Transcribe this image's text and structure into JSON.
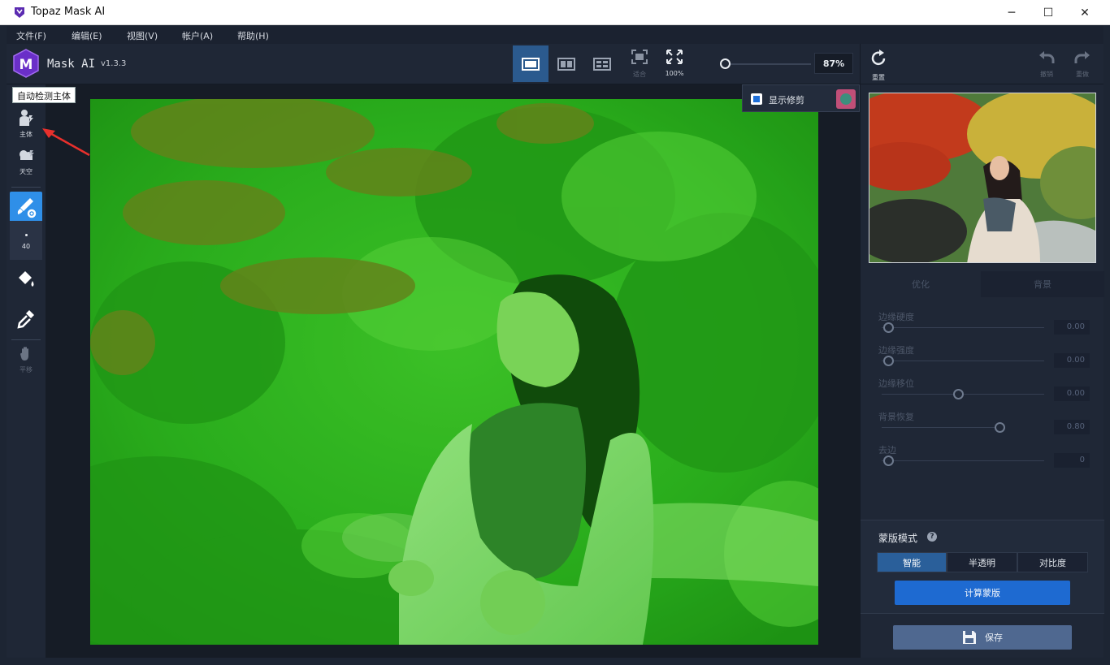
{
  "window": {
    "title": "Topaz Mask AI",
    "minimize": "─",
    "maximize": "☐",
    "close": "✕"
  },
  "menu": [
    {
      "label": "文件(F)"
    },
    {
      "label": "编辑(E)"
    },
    {
      "label": "视图(V)"
    },
    {
      "label": "帐户(A)"
    },
    {
      "label": "帮助(H)"
    }
  ],
  "toolbar": {
    "app_name": "Mask AI",
    "version": "v1.3.3",
    "fit_label": "适合",
    "zoom100_label": "100%",
    "zoom_value": "87%",
    "reset_label": "重置",
    "undo_label": "撤销",
    "redo_label": "重做"
  },
  "tools": {
    "subject_label": "主体",
    "sky_label": "天空",
    "brush_size": "40",
    "pan_label": "平移"
  },
  "tooltip": "自动检测主体",
  "show_trim": {
    "label": "显示修剪",
    "checked": true
  },
  "right_panel": {
    "tabs": [
      {
        "label": "优化"
      },
      {
        "label": "背景"
      }
    ],
    "params": [
      {
        "label": "边缘硬度",
        "value": "0.00"
      },
      {
        "label": "边缘强度",
        "value": "0.00"
      },
      {
        "label": "边缘移位",
        "value": "0.00"
      },
      {
        "label": "背景恢复",
        "value": "0.80"
      },
      {
        "label": "去边",
        "value": "0"
      }
    ],
    "mask_mode": {
      "title": "蒙版模式",
      "options": [
        {
          "label": "智能",
          "selected": true
        },
        {
          "label": "半透明"
        },
        {
          "label": "对比度"
        }
      ],
      "calc_label": "计算蒙版"
    },
    "save_label": "保存"
  },
  "colors": {
    "accent": "#1e6ad1",
    "panel": "#1f2736",
    "overlay": "#28c41e"
  }
}
